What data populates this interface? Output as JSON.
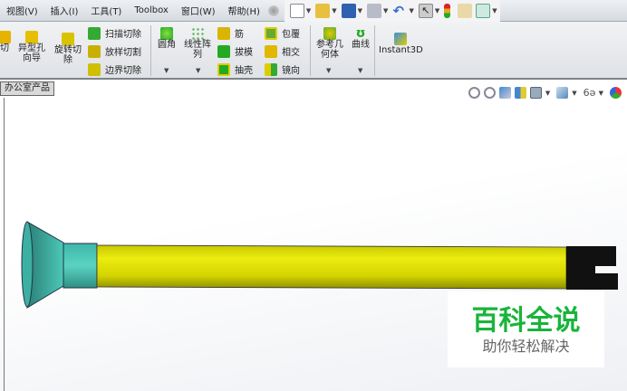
{
  "menubar": {
    "items": [
      "视图(V)",
      "插入(I)",
      "工具(T)",
      "Toolbox",
      "窗口(W)",
      "帮助(H)"
    ]
  },
  "quick_access": {
    "icons": [
      "pin-icon",
      "new-document-icon",
      "open-icon",
      "save-icon",
      "print-icon",
      "undo-icon",
      "select-icon",
      "rebuild-icon",
      "file-properties-icon",
      "options-icon"
    ]
  },
  "ribbon": {
    "cut_partial": "切",
    "hole_wizard": "异型孔\n向导",
    "revolve_cut": "旋转切\n除",
    "sweep_cut": "扫描切除",
    "loft_cut": "放样切割",
    "boundary_cut": "边界切除",
    "fillet": "圆角",
    "linear_pattern": "线性阵\n列",
    "rib": "筋",
    "draft": "拔模",
    "shell": "抽壳",
    "wrap": "包覆",
    "intersect": "相交",
    "mirror": "镜向",
    "reference_geometry": "参考几\n何体",
    "curves": "曲线",
    "instant3d": "Instant3D"
  },
  "document_tab": "办公室产品",
  "view_toolbar": {
    "icons": [
      "zoom-to-fit-icon",
      "zoom-area-icon",
      "previous-view-icon",
      "section-view-icon",
      "view-orientation-icon",
      "display-style-icon",
      "hide-show-icon",
      "appearance-icon"
    ]
  },
  "watermark": {
    "title": "百科全说",
    "subtitle": "助你轻松解决"
  },
  "colors": {
    "rod": "#d8d800",
    "collar": "#3fb7a8",
    "cap": "#111111",
    "watermark": "#19b43a"
  }
}
